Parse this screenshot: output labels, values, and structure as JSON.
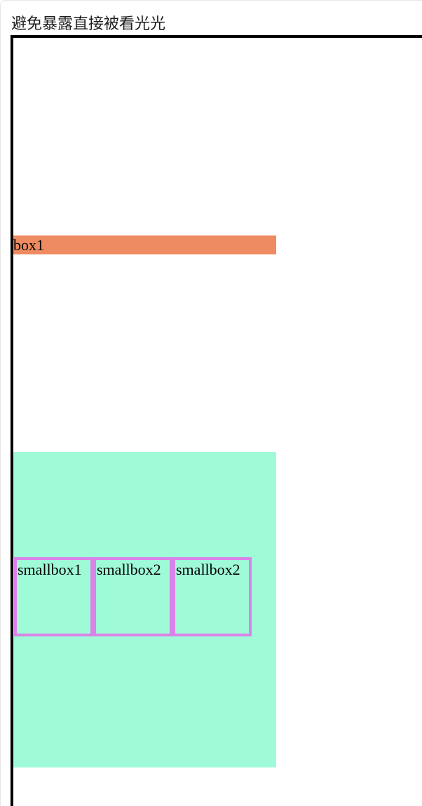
{
  "page": {
    "title": "避免暴露直接被看光光"
  },
  "boxes": {
    "box1": "box1",
    "smallboxes": [
      "smallbox1",
      "smallbox2",
      "smallbox2"
    ]
  },
  "colors": {
    "box1_background": "#ef8b60",
    "box2_background": "#9ffad8",
    "smallbox_border": "#d982e7",
    "container_border": "#000000"
  }
}
